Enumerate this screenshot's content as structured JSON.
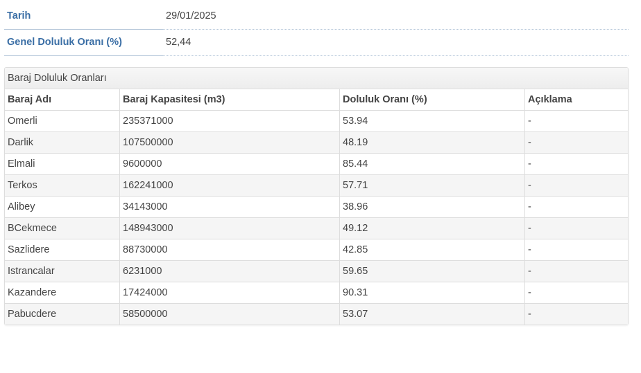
{
  "summary": {
    "date_label": "Tarih",
    "date_value": "29/01/2025",
    "overall_label": "Genel Doluluk Oranı (%)",
    "overall_value": "52,44"
  },
  "panel": {
    "title": "Baraj Doluluk Oranları",
    "columns": [
      "Baraj Adı",
      "Baraj Kapasitesi (m3)",
      "Doluluk Oranı (%)",
      "Açıklama"
    ],
    "rows": [
      [
        "Omerli",
        "235371000",
        "53.94",
        "-"
      ],
      [
        "Darlik",
        "107500000",
        "48.19",
        "-"
      ],
      [
        "Elmali",
        "9600000",
        "85.44",
        "-"
      ],
      [
        "Terkos",
        "162241000",
        "57.71",
        "-"
      ],
      [
        "Alibey",
        "34143000",
        "38.96",
        "-"
      ],
      [
        "BCekmece",
        "148943000",
        "49.12",
        "-"
      ],
      [
        "Sazlidere",
        "88730000",
        "42.85",
        "-"
      ],
      [
        "Istrancalar",
        "6231000",
        "59.65",
        "-"
      ],
      [
        "Kazandere",
        "17424000",
        "90.31",
        "-"
      ],
      [
        "Pabucdere",
        "58500000",
        "53.07",
        "-"
      ]
    ]
  },
  "colors": {
    "label_blue": "#3a6ea5",
    "text": "#444444",
    "border": "#dddddd",
    "stripe": "#f5f5f5"
  }
}
